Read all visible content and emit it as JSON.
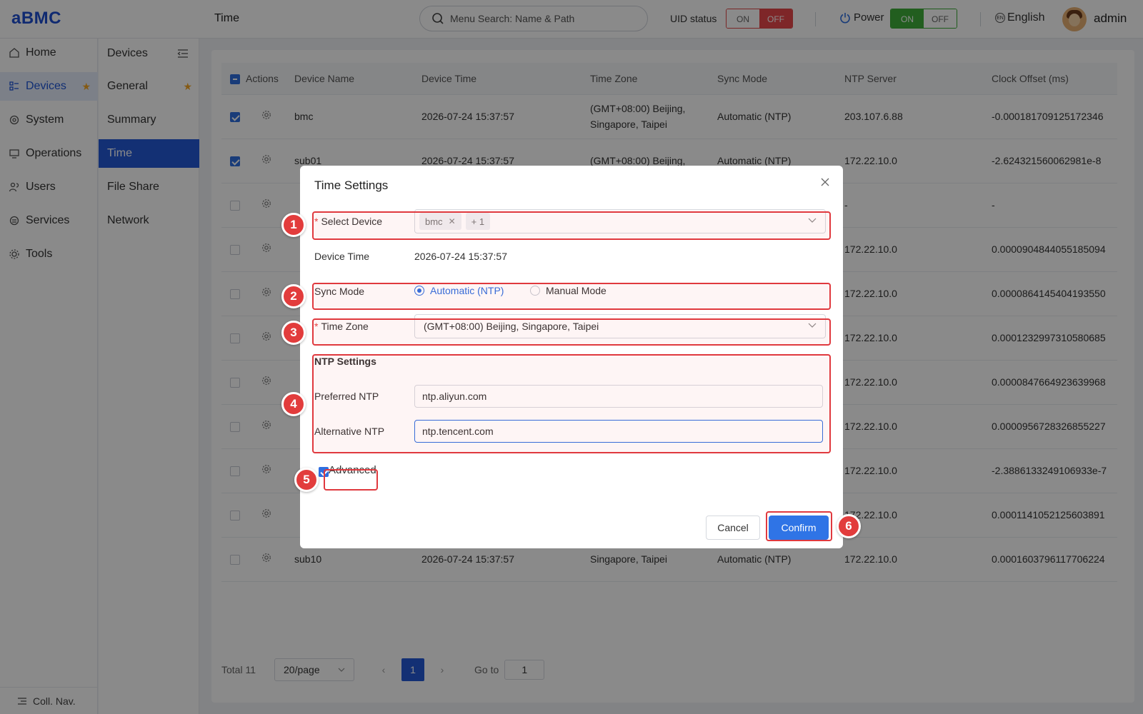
{
  "header": {
    "logo": "aBMC",
    "page_title": "Time",
    "search_placeholder": "Menu Search: Name & Path",
    "uid_status_label": "UID status",
    "uid_on": "ON",
    "uid_off": "OFF",
    "power_label": "Power",
    "power_on": "ON",
    "power_off": "OFF",
    "language": "English",
    "username": "admin"
  },
  "leftnav": {
    "items": [
      {
        "label": "Home",
        "icon": "home-icon"
      },
      {
        "label": "Devices",
        "icon": "devices-icon",
        "active": true,
        "starred": true
      },
      {
        "label": "System",
        "icon": "system-icon"
      },
      {
        "label": "Operations",
        "icon": "operations-icon"
      },
      {
        "label": "Users",
        "icon": "users-icon"
      },
      {
        "label": "Services",
        "icon": "services-icon"
      },
      {
        "label": "Tools",
        "icon": "tools-icon"
      }
    ],
    "collapse_label": "Coll. Nav."
  },
  "subnav": {
    "title": "Devices",
    "items": [
      {
        "label": "General",
        "starred": true
      },
      {
        "label": "Summary"
      },
      {
        "label": "Time",
        "active": true
      },
      {
        "label": "File Share"
      },
      {
        "label": "Network"
      }
    ]
  },
  "table": {
    "columns": [
      "Actions",
      "Device Name",
      "Device Time",
      "Time Zone",
      "Sync Mode",
      "NTP Server",
      "Clock Offset (ms)"
    ],
    "rows": [
      {
        "checked": true,
        "name": "bmc",
        "time": "2026-07-24 15:37:57",
        "tz": "(GMT+08:00) Beijing, Singapore, Taipei",
        "sync": "Automatic (NTP)",
        "ntp": "203.107.6.88",
        "offset": "-0.000181709125172346"
      },
      {
        "checked": true,
        "name": "sub01",
        "time": "2026-07-24 15:37:57",
        "tz": "(GMT+08:00) Beijing,",
        "sync": "Automatic (NTP)",
        "ntp": "172.22.10.0",
        "offset": "-2.624321560062981e-8"
      },
      {
        "checked": false,
        "name": "",
        "time": "",
        "tz": "",
        "sync": "",
        "ntp": "-",
        "offset": "-"
      },
      {
        "checked": false,
        "name": "",
        "time": "",
        "tz": "",
        "sync": "",
        "ntp": "172.22.10.0",
        "offset": "0.0000904844055185094"
      },
      {
        "checked": false,
        "name": "",
        "time": "",
        "tz": "",
        "sync": "",
        "ntp": "172.22.10.0",
        "offset": "0.0000864145404193550"
      },
      {
        "checked": false,
        "name": "",
        "time": "",
        "tz": "",
        "sync": "",
        "ntp": "172.22.10.0",
        "offset": "0.0001232997310580685"
      },
      {
        "checked": false,
        "name": "",
        "time": "",
        "tz": "",
        "sync": "",
        "ntp": "172.22.10.0",
        "offset": "0.0000847664923639968"
      },
      {
        "checked": false,
        "name": "",
        "time": "",
        "tz": "",
        "sync": "",
        "ntp": "172.22.10.0",
        "offset": "0.0000956728326855227"
      },
      {
        "checked": false,
        "name": "",
        "time": "",
        "tz": "",
        "sync": "",
        "ntp": "172.22.10.0",
        "offset": "-2.3886133249106933e-7"
      },
      {
        "checked": false,
        "name": "",
        "time": "",
        "tz": "",
        "sync": "",
        "ntp": "172.22.10.0",
        "offset": "0.0001141052125603891"
      },
      {
        "checked": false,
        "name": "sub10",
        "time": "2026-07-24 15:37:57",
        "tz": "Singapore, Taipei",
        "sync": "Automatic (NTP)",
        "ntp": "172.22.10.0",
        "offset": "0.0001603796117706224"
      }
    ]
  },
  "pagination": {
    "total": "Total 11",
    "page_size": "20/page",
    "current_page": "1",
    "goto_label": "Go to",
    "goto_value": "1"
  },
  "modal": {
    "title": "Time Settings",
    "select_device_label": "Select Device",
    "selected_tag": "bmc",
    "more_tag": "+ 1",
    "device_time_label": "Device Time",
    "device_time_value": "2026-07-24 15:37:57",
    "sync_mode_label": "Sync Mode",
    "sync_auto": "Automatic (NTP)",
    "sync_manual": "Manual Mode",
    "time_zone_label": "Time Zone",
    "time_zone_value": "(GMT+08:00) Beijing, Singapore, Taipei",
    "ntp_section": "NTP Settings",
    "preferred_ntp_label": "Preferred NTP",
    "preferred_ntp_value": "ntp.aliyun.com",
    "alternative_ntp_label": "Alternative NTP",
    "alternative_ntp_value": "ntp.tencent.com",
    "advanced_label": "Advanced",
    "cancel": "Cancel",
    "confirm": "Confirm"
  },
  "annotations": [
    "1",
    "2",
    "3",
    "4",
    "5",
    "6"
  ],
  "colors": {
    "primary": "#2459d6",
    "highlight": "#e0393e",
    "uid_off": "#e9474a",
    "power_on": "#3fae3a"
  }
}
